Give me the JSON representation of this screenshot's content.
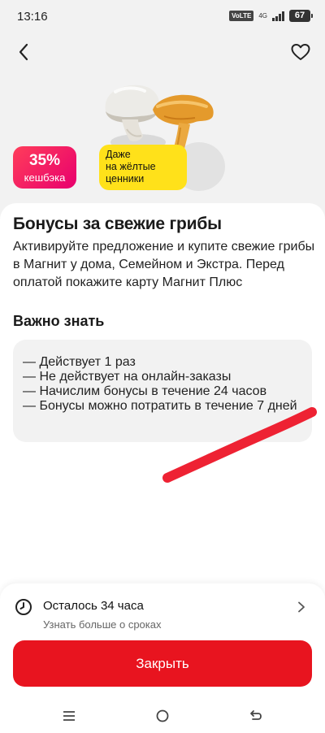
{
  "status_bar": {
    "time": "13:16",
    "volte": "VoLTE",
    "network": "4G",
    "battery": "67"
  },
  "hero": {
    "back_icon": "chevron-left-icon",
    "favorite_icon": "heart-outline-icon",
    "image": "mushrooms-champignon-chanterelle",
    "cashback_value": "35%",
    "cashback_label": "кешбэка",
    "yellow_tag": [
      "Даже",
      "на жёлтые",
      "ценники"
    ]
  },
  "offer": {
    "title": "Бонусы за свежие грибы",
    "description": "Активируйте предложение и купите свежие грибы в Магнит у дома, Семейном и Экстра. Перед оплатой покажите карту Магнит Плюс",
    "section_title": "Важно знать",
    "rules": [
      "— Действует 1 раз",
      "— Не действует на онлайн-заказы",
      "— Начислим бонусы в течение 24 часов",
      "— Бонусы можно потратить в течение 7 дней"
    ]
  },
  "bottom": {
    "timer_icon": "clock-icon",
    "timer_title": "Осталось 34 часа",
    "timer_subtitle": "Узнать больше о сроках",
    "close_button": "Закрыть"
  },
  "nav": {
    "menu_icon": "menu-icon",
    "home_icon": "home-circle-icon",
    "back_icon": "back-arrow-icon"
  },
  "colors": {
    "accent": "#e8141f",
    "cashback_gradient_start": "#ff3d5a",
    "cashback_gradient_end": "#e8006e",
    "yellow_badge": "#ffe11a",
    "annotation_stroke": "#ee2233"
  }
}
